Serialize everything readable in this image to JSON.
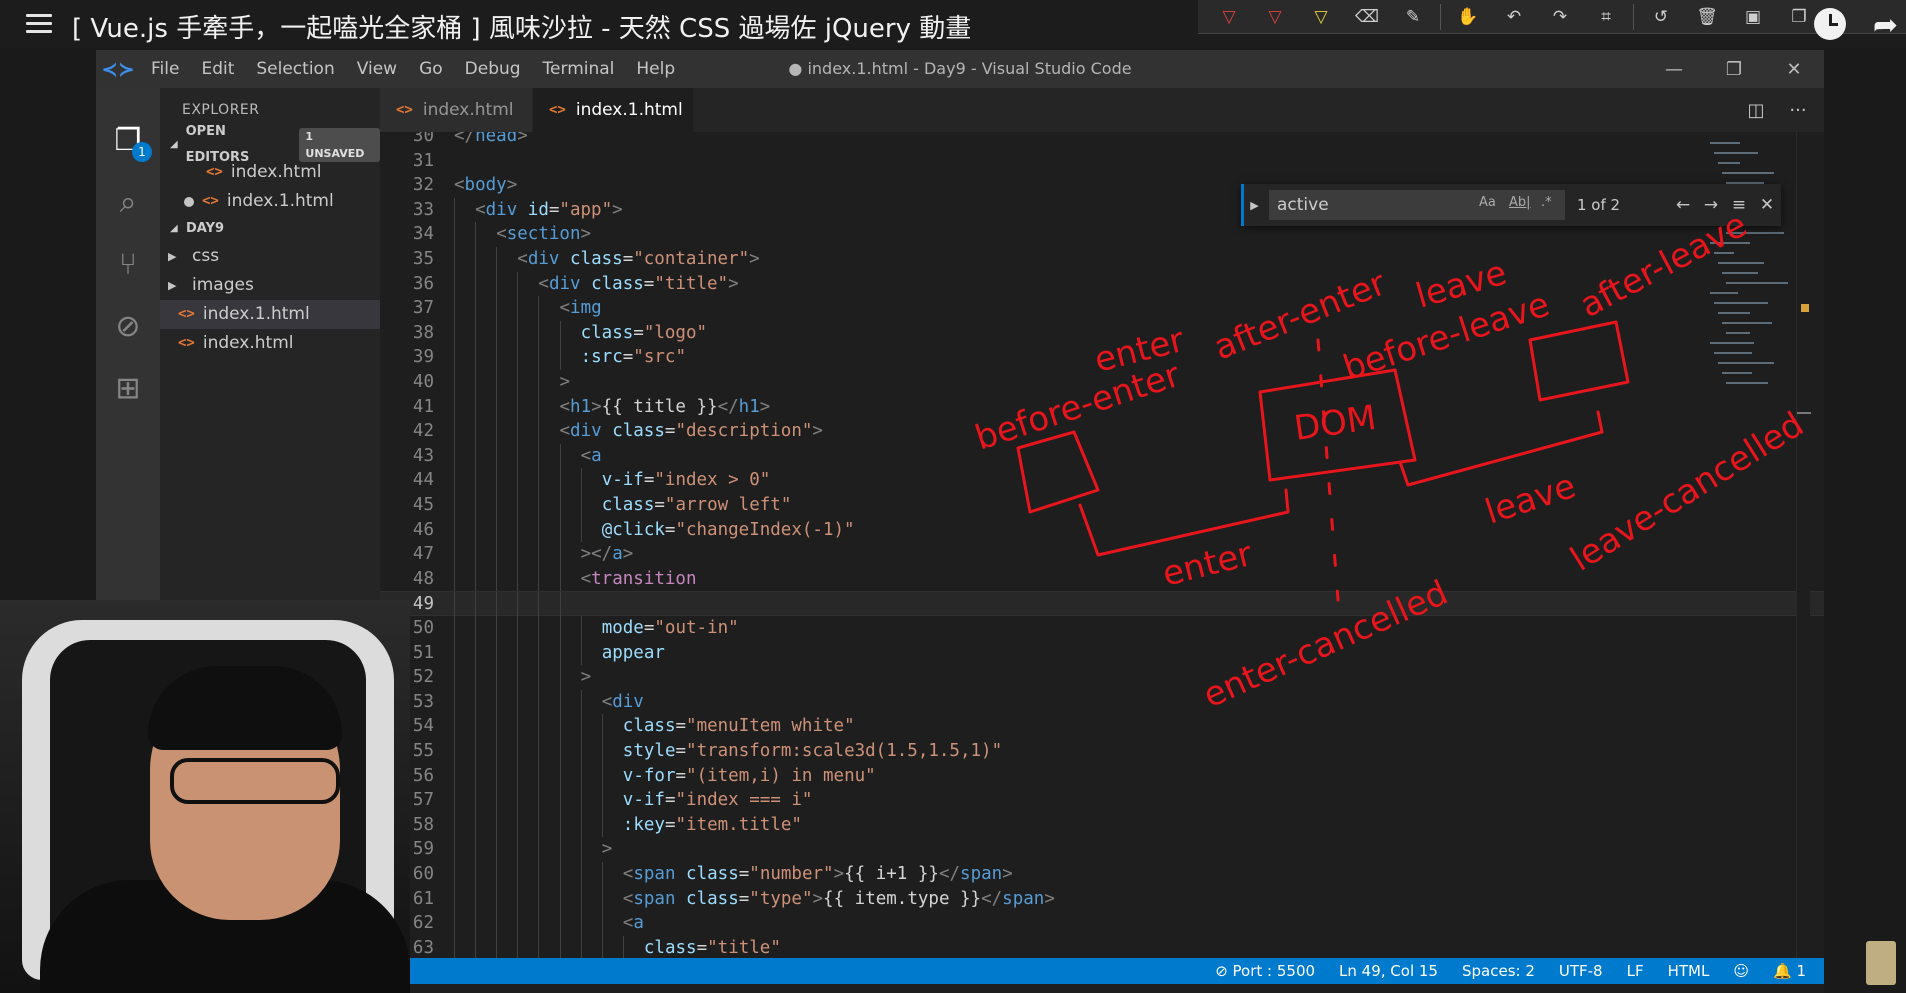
{
  "video": {
    "title": "[ Vue.js 手牽手，一起嗑光全家桶 ] 風味沙拉 - 天然 CSS 過場佐 jQuery 動畫"
  },
  "toolbar": {
    "tools": [
      {
        "icon": "red-marker-icon",
        "glyph": "▽"
      },
      {
        "icon": "red-pen-icon",
        "glyph": "▽"
      },
      {
        "icon": "highlighter-icon",
        "glyph": "▽"
      },
      {
        "icon": "eraser-icon",
        "glyph": "⌫"
      },
      {
        "icon": "pencil-icon",
        "glyph": "✎"
      },
      {
        "icon": "hand-icon",
        "glyph": "✋"
      },
      {
        "icon": "undo-icon",
        "glyph": "↶"
      },
      {
        "icon": "redo-icon",
        "glyph": "↷"
      },
      {
        "icon": "crop-icon",
        "glyph": "⌗"
      },
      {
        "icon": "history-icon",
        "glyph": "↺"
      },
      {
        "icon": "trash-icon",
        "glyph": "🗑"
      },
      {
        "icon": "save-icon",
        "glyph": "▣"
      },
      {
        "icon": "copy-icon",
        "glyph": "❐"
      }
    ]
  },
  "window": {
    "title": "● index.1.html - Day9 - Visual Studio Code",
    "menu": [
      "File",
      "Edit",
      "Selection",
      "View",
      "Go",
      "Debug",
      "Terminal",
      "Help"
    ],
    "controls": {
      "minimize": "—",
      "restore": "❐",
      "close": "✕"
    }
  },
  "activity_bar": {
    "explorer_badge": "1"
  },
  "explorer": {
    "header": "EXPLORER",
    "open_editors_label": "OPEN EDITORS",
    "unsaved_badge": "1 UNSAVED",
    "open_editors": [
      "index.html",
      "index.1.html"
    ],
    "folder_label": "DAY9",
    "folders": [
      "css",
      "images"
    ],
    "files": [
      "index.1.html",
      "index.html"
    ]
  },
  "tabs": [
    {
      "label": "index.html",
      "active": false
    },
    {
      "label": "index.1.html",
      "active": true,
      "dirty": true
    }
  ],
  "find_widget": {
    "query": "active",
    "count": "1 of 2",
    "match_case": "Aa",
    "whole_word": "Ab|",
    "regex": ".*"
  },
  "editor": {
    "current_line": 49,
    "lines": [
      {
        "n": "30",
        "indent": 0,
        "segs": [
          [
            "b",
            "</"
          ],
          [
            "t",
            "head"
          ],
          [
            "b",
            ">"
          ]
        ]
      },
      {
        "n": "31",
        "indent": 0,
        "segs": []
      },
      {
        "n": "32",
        "indent": 0,
        "segs": [
          [
            "b",
            "<"
          ],
          [
            "t",
            "body"
          ],
          [
            "b",
            ">"
          ]
        ]
      },
      {
        "n": "33",
        "indent": 1,
        "segs": [
          [
            "b",
            "<"
          ],
          [
            "t",
            "div"
          ],
          [
            "x",
            " "
          ],
          [
            "a",
            "id"
          ],
          [
            "x",
            "="
          ],
          [
            "s",
            "\"app\""
          ],
          [
            "b",
            ">"
          ]
        ]
      },
      {
        "n": "34",
        "indent": 2,
        "segs": [
          [
            "b",
            "<"
          ],
          [
            "t",
            "section"
          ],
          [
            "b",
            ">"
          ]
        ]
      },
      {
        "n": "35",
        "indent": 3,
        "segs": [
          [
            "b",
            "<"
          ],
          [
            "t",
            "div"
          ],
          [
            "x",
            " "
          ],
          [
            "a",
            "class"
          ],
          [
            "x",
            "="
          ],
          [
            "s",
            "\"container\""
          ],
          [
            "b",
            ">"
          ]
        ]
      },
      {
        "n": "36",
        "indent": 4,
        "segs": [
          [
            "b",
            "<"
          ],
          [
            "t",
            "div"
          ],
          [
            "x",
            " "
          ],
          [
            "a",
            "class"
          ],
          [
            "x",
            "="
          ],
          [
            "s",
            "\"title\""
          ],
          [
            "b",
            ">"
          ]
        ]
      },
      {
        "n": "37",
        "indent": 5,
        "segs": [
          [
            "b",
            "<"
          ],
          [
            "t",
            "img"
          ]
        ]
      },
      {
        "n": "38",
        "indent": 6,
        "segs": [
          [
            "a",
            "class"
          ],
          [
            "x",
            "="
          ],
          [
            "s",
            "\"logo\""
          ]
        ]
      },
      {
        "n": "39",
        "indent": 6,
        "segs": [
          [
            "a",
            ":src"
          ],
          [
            "x",
            "="
          ],
          [
            "s",
            "\"src\""
          ]
        ]
      },
      {
        "n": "40",
        "indent": 5,
        "segs": [
          [
            "b",
            ">"
          ]
        ]
      },
      {
        "n": "41",
        "indent": 5,
        "segs": [
          [
            "b",
            "<"
          ],
          [
            "t",
            "h1"
          ],
          [
            "b",
            ">"
          ],
          [
            "x",
            "{{ title }}"
          ],
          [
            "b",
            "</"
          ],
          [
            "t",
            "h1"
          ],
          [
            "b",
            ">"
          ]
        ]
      },
      {
        "n": "42",
        "indent": 5,
        "segs": [
          [
            "b",
            "<"
          ],
          [
            "t",
            "div"
          ],
          [
            "x",
            " "
          ],
          [
            "a",
            "class"
          ],
          [
            "x",
            "="
          ],
          [
            "s",
            "\"description\""
          ],
          [
            "b",
            ">"
          ]
        ]
      },
      {
        "n": "43",
        "indent": 6,
        "segs": [
          [
            "b",
            "<"
          ],
          [
            "t",
            "a"
          ]
        ]
      },
      {
        "n": "44",
        "indent": 7,
        "segs": [
          [
            "a",
            "v-if"
          ],
          [
            "x",
            "="
          ],
          [
            "s",
            "\"index > 0\""
          ]
        ]
      },
      {
        "n": "45",
        "indent": 7,
        "segs": [
          [
            "a",
            "class"
          ],
          [
            "x",
            "="
          ],
          [
            "s",
            "\"arrow left\""
          ]
        ]
      },
      {
        "n": "46",
        "indent": 7,
        "segs": [
          [
            "a",
            "@click"
          ],
          [
            "x",
            "="
          ],
          [
            "s",
            "\"changeIndex(-1)\""
          ]
        ]
      },
      {
        "n": "47",
        "indent": 6,
        "segs": [
          [
            "b",
            "></"
          ],
          [
            "t",
            "a"
          ],
          [
            "b",
            ">"
          ]
        ]
      },
      {
        "n": "48",
        "indent": 6,
        "segs": [
          [
            "b",
            "<"
          ],
          [
            "v",
            "transition"
          ]
        ]
      },
      {
        "n": "49",
        "indent": 6,
        "segs": []
      },
      {
        "n": "50",
        "indent": 7,
        "segs": [
          [
            "a",
            "mode"
          ],
          [
            "x",
            "="
          ],
          [
            "s",
            "\"out-in\""
          ]
        ]
      },
      {
        "n": "51",
        "indent": 7,
        "segs": [
          [
            "a",
            "appear"
          ]
        ]
      },
      {
        "n": "52",
        "indent": 6,
        "segs": [
          [
            "b",
            ">"
          ]
        ]
      },
      {
        "n": "53",
        "indent": 7,
        "segs": [
          [
            "b",
            "<"
          ],
          [
            "t",
            "div"
          ]
        ]
      },
      {
        "n": "54",
        "indent": 8,
        "segs": [
          [
            "a",
            "class"
          ],
          [
            "x",
            "="
          ],
          [
            "s",
            "\"menuItem white\""
          ]
        ]
      },
      {
        "n": "55",
        "indent": 8,
        "segs": [
          [
            "a",
            "style"
          ],
          [
            "x",
            "="
          ],
          [
            "s",
            "\"transform:scale3d(1.5,1.5,1)\""
          ]
        ]
      },
      {
        "n": "56",
        "indent": 8,
        "segs": [
          [
            "a",
            "v-for"
          ],
          [
            "x",
            "="
          ],
          [
            "s",
            "\"(item,i) in menu\""
          ]
        ]
      },
      {
        "n": "57",
        "indent": 8,
        "segs": [
          [
            "a",
            "v-if"
          ],
          [
            "x",
            "="
          ],
          [
            "s",
            "\"index === i\""
          ]
        ]
      },
      {
        "n": "58",
        "indent": 8,
        "segs": [
          [
            "a",
            ":key"
          ],
          [
            "x",
            "="
          ],
          [
            "s",
            "\"item.title\""
          ]
        ]
      },
      {
        "n": "59",
        "indent": 7,
        "segs": [
          [
            "b",
            ">"
          ]
        ]
      },
      {
        "n": "60",
        "indent": 8,
        "segs": [
          [
            "b",
            "<"
          ],
          [
            "t",
            "span"
          ],
          [
            "x",
            " "
          ],
          [
            "a",
            "class"
          ],
          [
            "x",
            "="
          ],
          [
            "s",
            "\"number\""
          ],
          [
            "b",
            ">"
          ],
          [
            "x",
            "{{ i+1 }}"
          ],
          [
            "b",
            "</"
          ],
          [
            "t",
            "span"
          ],
          [
            "b",
            ">"
          ]
        ]
      },
      {
        "n": "61",
        "indent": 8,
        "segs": [
          [
            "b",
            "<"
          ],
          [
            "t",
            "span"
          ],
          [
            "x",
            " "
          ],
          [
            "a",
            "class"
          ],
          [
            "x",
            "="
          ],
          [
            "s",
            "\"type\""
          ],
          [
            "b",
            ">"
          ],
          [
            "x",
            "{{ item.type }}"
          ],
          [
            "b",
            "</"
          ],
          [
            "t",
            "span"
          ],
          [
            "b",
            ">"
          ]
        ]
      },
      {
        "n": "62",
        "indent": 8,
        "segs": [
          [
            "b",
            "<"
          ],
          [
            "t",
            "a"
          ]
        ]
      },
      {
        "n": "63",
        "indent": 9,
        "segs": [
          [
            "a",
            "class"
          ],
          [
            "x",
            "="
          ],
          [
            "s",
            "\"title\""
          ]
        ]
      }
    ]
  },
  "statusbar": {
    "port": "⊘ Port : 5500",
    "position": "Ln 49, Col 15",
    "spaces": "Spaces: 2",
    "encoding": "UTF-8",
    "eol": "LF",
    "language": "HTML",
    "feedback": "☺",
    "notifications": "🔔 1"
  },
  "annotations": {
    "labels": [
      "before-enter",
      "enter",
      "after-enter",
      "DOM",
      "before-leave",
      "leave",
      "after-leave",
      "enter",
      "leave",
      "leave-cancelled",
      "enter-cancelled"
    ]
  },
  "colors": {
    "accent": "#007acc",
    "annotation": "#e8151c"
  }
}
